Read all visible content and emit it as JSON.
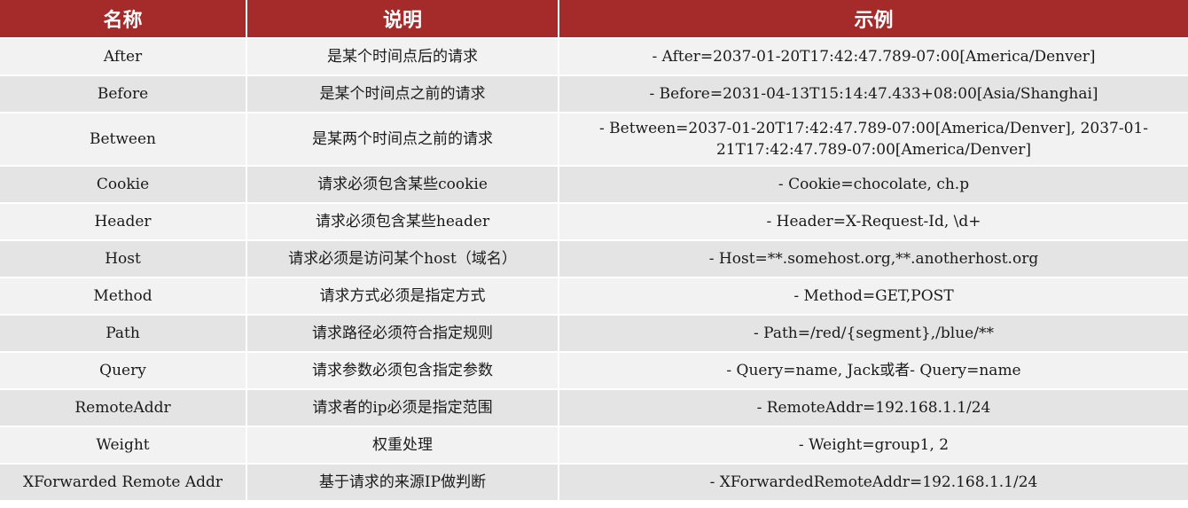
{
  "header": {
    "name": "名称",
    "description": "说明",
    "example": "示例"
  },
  "rows": [
    {
      "name": "After",
      "description": "是某个时间点后的请求",
      "example": "- After=2037-01-20T17:42:47.789-07:00[America/Denver]"
    },
    {
      "name": "Before",
      "description": "是某个时间点之前的请求",
      "example": "- Before=2031-04-13T15:14:47.433+08:00[Asia/Shanghai]"
    },
    {
      "name": "Between",
      "description": "是某两个时间点之前的请求",
      "example": "- Between=2037-01-20T17:42:47.789-07:00[America/Denver], 2037-01-21T17:42:47.789-07:00[America/Denver]"
    },
    {
      "name": "Cookie",
      "description": "请求必须包含某些cookie",
      "example": "- Cookie=chocolate, ch.p"
    },
    {
      "name": "Header",
      "description": "请求必须包含某些header",
      "example": "- Header=X-Request-Id, \\d+"
    },
    {
      "name": "Host",
      "description": "请求必须是访问某个host（域名）",
      "example": "- Host=**.somehost.org,**.anotherhost.org"
    },
    {
      "name": "Method",
      "description": "请求方式必须是指定方式",
      "example": "- Method=GET,POST"
    },
    {
      "name": "Path",
      "description": "请求路径必须符合指定规则",
      "example": "- Path=/red/{segment},/blue/**"
    },
    {
      "name": "Query",
      "description": "请求参数必须包含指定参数",
      "example": "- Query=name, Jack或者- Query=name"
    },
    {
      "name": "RemoteAddr",
      "description": "请求者的ip必须是指定范围",
      "example": "- RemoteAddr=192.168.1.1/24"
    },
    {
      "name": "Weight",
      "description": "权重处理",
      "example": "- Weight=group1, 2"
    },
    {
      "name": "XForwarded Remote Addr",
      "description": "基于请求的来源IP做判断",
      "example": "- XForwardedRemoteAddr=192.168.1.1/24"
    }
  ],
  "colors": {
    "header_bg": "#a52a2a",
    "row_light": "#f2f2f2",
    "row_dark": "#e4e4e4"
  }
}
